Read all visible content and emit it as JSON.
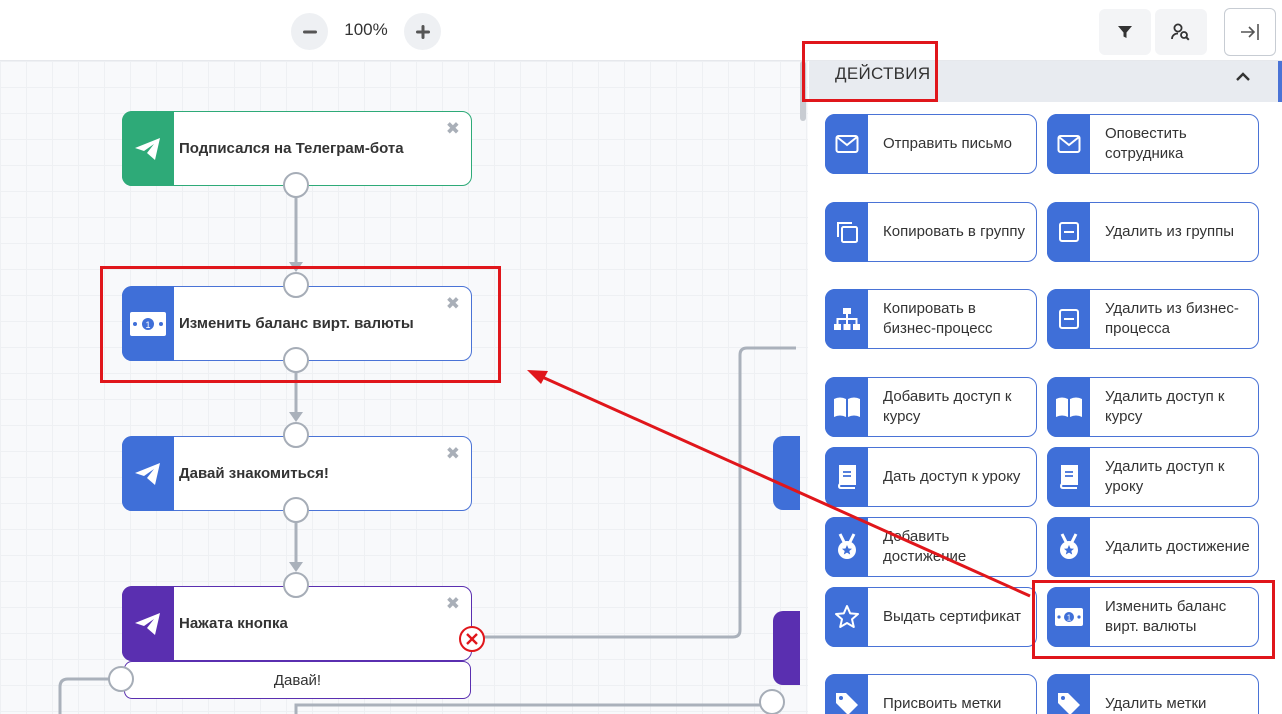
{
  "toolbar": {
    "zoom_level": "100%",
    "zoom_out_icon": "minus-icon",
    "zoom_in_icon": "plus-icon",
    "filter_icon": "filter-icon",
    "user_search_icon": "user-search-icon",
    "exit_icon": "arrow-right-to-line-icon"
  },
  "canvas": {
    "nodes": [
      {
        "title": "Подписался на Телеграм-бота",
        "color": "#2eaa78",
        "icon": "telegram-icon"
      },
      {
        "title": "Изменить баланс вирт. валюты",
        "color": "#3f6fd8",
        "icon": "money-bill-icon"
      },
      {
        "title": "Давай знакомиться!",
        "color": "#3f6fd8",
        "icon": "telegram-icon"
      },
      {
        "title": "Нажата кнопка",
        "color": "#5a2fb0",
        "icon": "telegram-icon"
      }
    ],
    "close_glyph": "✖",
    "button_option": "Давай!"
  },
  "panel": {
    "title": "ДЕЙСТВИЯ",
    "actions": [
      {
        "label": "Отправить письмо",
        "icon": "envelope-icon"
      },
      {
        "label": "Оповестить сотрудника",
        "icon": "envelope-icon"
      },
      {
        "label": "Копировать в группу",
        "icon": "copy-icon"
      },
      {
        "label": "Удалить из группы",
        "icon": "minus-square-icon"
      },
      {
        "label": "Копировать в бизнес-процесс",
        "icon": "sitemap-icon"
      },
      {
        "label": "Удалить из бизнес-процесса",
        "icon": "minus-square-icon"
      },
      {
        "label": "Добавить доступ к курсу",
        "icon": "book-open-icon"
      },
      {
        "label": "Удалить доступ к курсу",
        "icon": "book-open-icon"
      },
      {
        "label": "Дать доступ к уроку",
        "icon": "book-icon"
      },
      {
        "label": "Удалить доступ к уроку",
        "icon": "book-icon"
      },
      {
        "label": "Добавить достижение",
        "icon": "medal-icon"
      },
      {
        "label": "Удалить достижение",
        "icon": "medal-icon"
      },
      {
        "label": "Выдать сертификат",
        "icon": "star-icon"
      },
      {
        "label": "Изменить баланс вирт. валюты",
        "icon": "money-bill-icon"
      },
      {
        "label": "Присвоить метки",
        "icon": "tag-icon"
      },
      {
        "label": "Удалить метки",
        "icon": "tag-icon"
      }
    ]
  },
  "annotations": {
    "highlight_color": "#e0161b"
  }
}
